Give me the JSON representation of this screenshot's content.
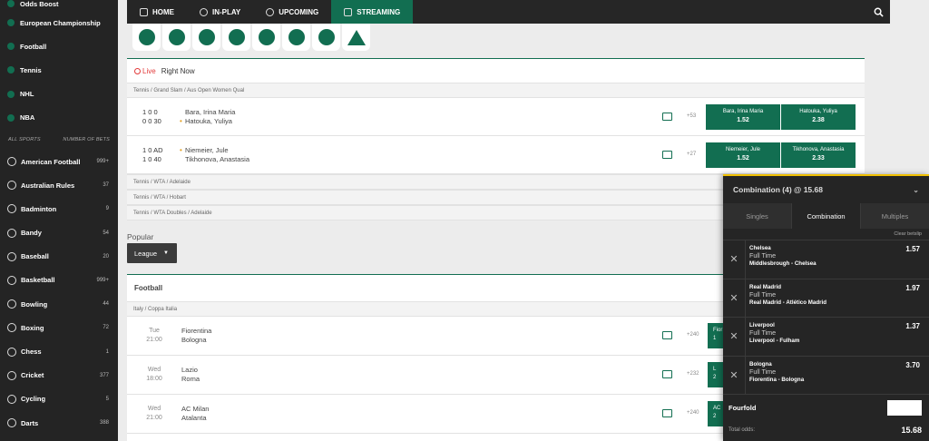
{
  "sidebar": {
    "top_items": [
      "Odds Boost",
      "European Championship",
      "Football",
      "Tennis",
      "NHL",
      "NBA"
    ],
    "header_left": "ALL SPORTS",
    "header_right": "NUMBER OF BETS",
    "sports": [
      {
        "name": "American Football",
        "count": "999+"
      },
      {
        "name": "Australian Rules",
        "count": "37"
      },
      {
        "name": "Badminton",
        "count": "9"
      },
      {
        "name": "Bandy",
        "count": "54"
      },
      {
        "name": "Baseball",
        "count": "20"
      },
      {
        "name": "Basketball",
        "count": "999+"
      },
      {
        "name": "Bowling",
        "count": "44"
      },
      {
        "name": "Boxing",
        "count": "72"
      },
      {
        "name": "Chess",
        "count": "1"
      },
      {
        "name": "Cricket",
        "count": "377"
      },
      {
        "name": "Cycling",
        "count": "5"
      },
      {
        "name": "Darts",
        "count": "388"
      }
    ]
  },
  "nav": {
    "tabs": [
      "HOME",
      "IN-PLAY",
      "UPCOMING",
      "STREAMING"
    ],
    "active": "STREAMING"
  },
  "live": {
    "label": "Live",
    "title": "Right Now",
    "breadcrumbs": [
      "Tennis / Grand Slam / Aus Open Women Qual",
      "Tennis / WTA / Adelaide",
      "Tennis / WTA / Hobart",
      "Tennis / WTA Doubles / Adelaide"
    ],
    "matches": [
      {
        "score1": "1 0 0",
        "score2": "0 0 30",
        "serve": "2",
        "p1": "Bara, Irina Maria",
        "p2": "Hatouka, Yuliya",
        "more": "+53",
        "odd1_name": "Bara, Irina Maria",
        "odd1": "1.52",
        "odd2_name": "Hatouka, Yuliya",
        "odd2": "2.38"
      },
      {
        "score1": "1 0 AD",
        "score2": "1 0 40",
        "serve": "1",
        "p1": "Niemeier, Jule",
        "p2": "Tikhonova, Anastasia",
        "more": "+27",
        "odd1_name": "Niemeier, Jule",
        "odd1": "1.52",
        "odd2_name": "Tikhonova, Anastasia",
        "odd2": "2.33"
      }
    ]
  },
  "popular": {
    "title": "Popular",
    "filter": "League"
  },
  "football": {
    "title": "Football",
    "breadcrumb": "Italy / Coppa Italia",
    "matches": [
      {
        "day": "Tue",
        "time": "21:00",
        "home": "Fiorentina",
        "away": "Bologna",
        "more": "+240",
        "odd_label": "Fior",
        "odd_val": "1"
      },
      {
        "day": "Wed",
        "time": "18:00",
        "home": "Lazio",
        "away": "Roma",
        "more": "+232",
        "odd_label": "L",
        "odd_val": "2"
      },
      {
        "day": "Wed",
        "time": "21:00",
        "home": "AC Milan",
        "away": "Atalanta",
        "more": "+240",
        "odd_label": "AC",
        "odd_val": "2"
      }
    ]
  },
  "betslip": {
    "title": "Combination (4) @ 15.68",
    "tabs": [
      "Singles",
      "Combination",
      "Multiples"
    ],
    "active_tab": "Combination",
    "clear": "Clear betslip",
    "selections": [
      {
        "team": "Chelsea",
        "market": "Full Time",
        "event": "Middlesbrough - Chelsea",
        "price": "1.57"
      },
      {
        "team": "Real Madrid",
        "market": "Full Time",
        "event": "Real Madrid - Atlético Madrid",
        "price": "1.97"
      },
      {
        "team": "Liverpool",
        "market": "Full Time",
        "event": "Liverpool - Fulham",
        "price": "1.37"
      },
      {
        "team": "Bologna",
        "market": "Full Time",
        "event": "Fiorentina - Bologna",
        "price": "3.70"
      }
    ],
    "bet_type": "Fourfold",
    "total_label": "Total odds:",
    "total": "15.68"
  },
  "colors": {
    "accent": "#126e51",
    "sidebar": "#242424",
    "highlight": "#f0c000"
  }
}
